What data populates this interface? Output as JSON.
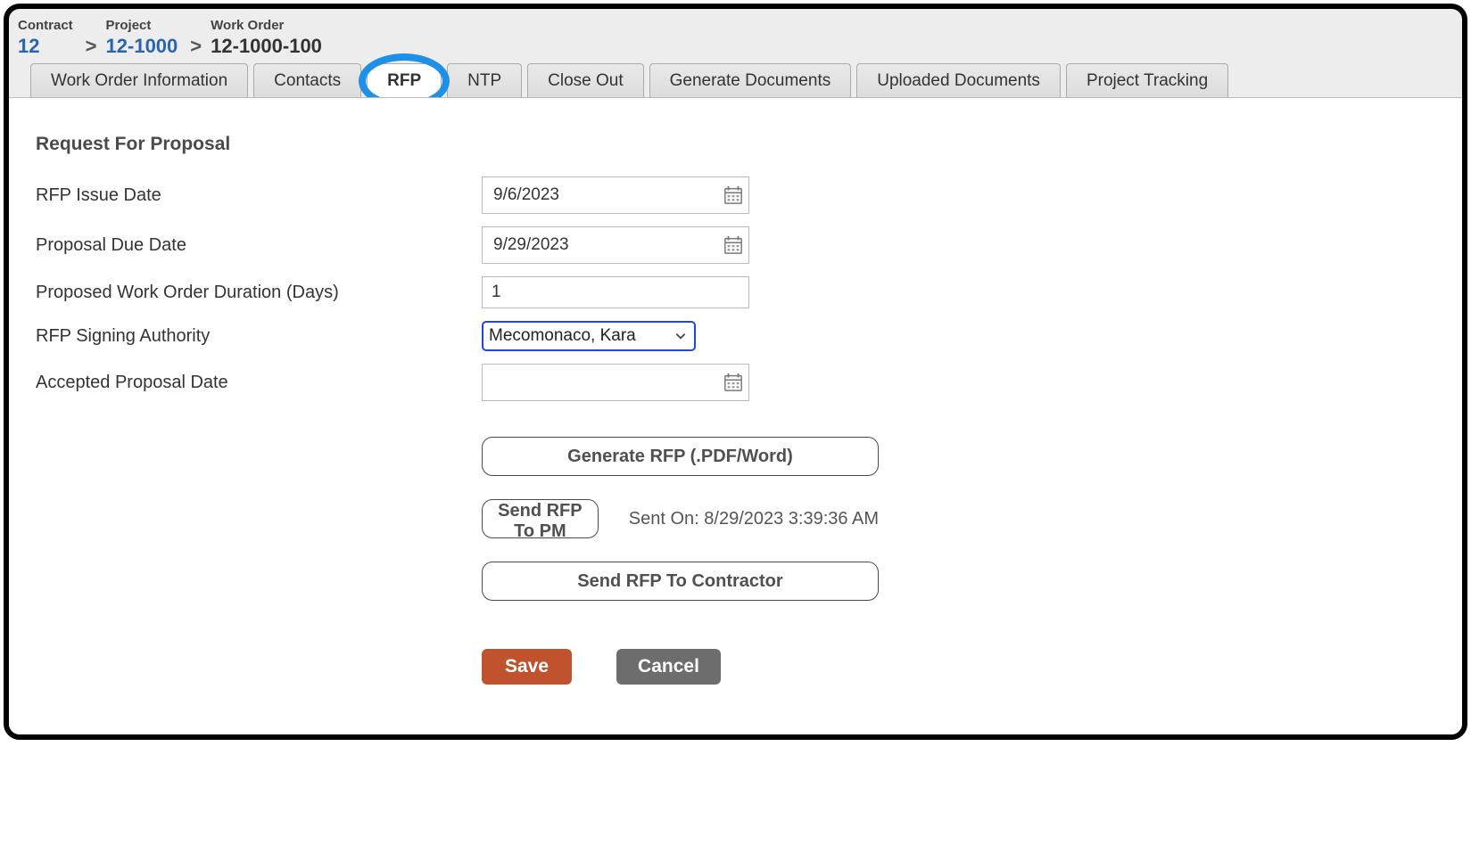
{
  "breadcrumb": {
    "contract_label": "Contract",
    "contract_value": "12",
    "project_label": "Project",
    "project_value": "12-1000",
    "workorder_label": "Work Order",
    "workorder_value": "12-1000-100",
    "sep": ">"
  },
  "tabs": {
    "wo_info": "Work Order Information",
    "contacts": "Contacts",
    "rfp": "RFP",
    "ntp": "NTP",
    "close_out": "Close Out",
    "generate_docs": "Generate Documents",
    "uploaded_docs": "Uploaded Documents",
    "project_tracking": "Project Tracking"
  },
  "section": {
    "title": "Request For Proposal"
  },
  "form": {
    "issue_date_label": "RFP Issue Date",
    "issue_date_value": "9/6/2023",
    "due_date_label": "Proposal Due Date",
    "due_date_value": "9/29/2023",
    "duration_label": "Proposed Work Order Duration (Days)",
    "duration_value": "1",
    "signing_auth_label": "RFP Signing Authority",
    "signing_auth_value": "Mecomonaco, Kara",
    "accepted_date_label": "Accepted Proposal Date",
    "accepted_date_value": ""
  },
  "actions": {
    "generate_rfp": "Generate RFP (.PDF/Word)",
    "send_pm": "Send RFP To PM",
    "send_contractor": "Send RFP To Contractor",
    "sent_on": "Sent On: 8/29/2023 3:39:36 AM"
  },
  "footer": {
    "save": "Save",
    "cancel": "Cancel"
  }
}
